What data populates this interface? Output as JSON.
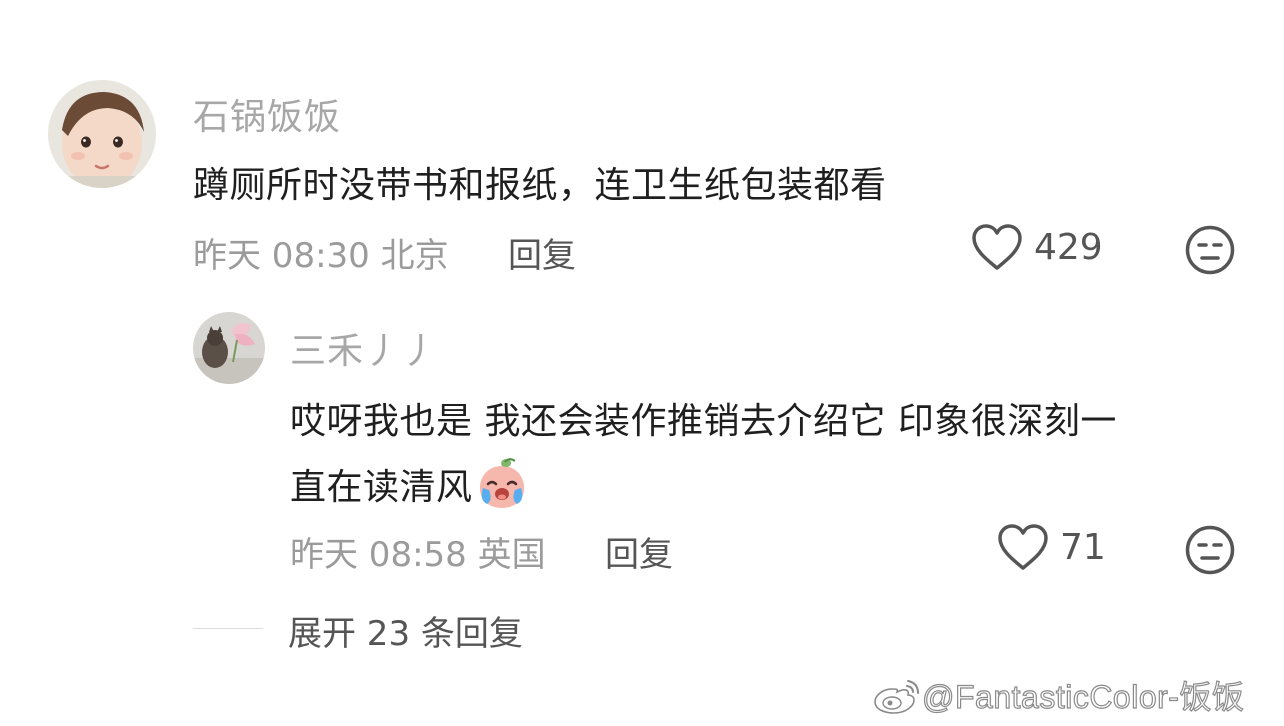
{
  "comments": [
    {
      "username": "石锅饭饭",
      "text": "蹲厕所时没带书和报纸，连卫生纸包装都看",
      "time": "昨天 08:30",
      "location": "北京",
      "reply_label": "回复",
      "likes": "429"
    }
  ],
  "reply": {
    "username": "三禾丿丿",
    "text_line1": "哎呀我也是 我还会装作推销去介绍它 印象很深刻一",
    "text_line2": "直在读清风",
    "time": "昨天 08:58",
    "location": "英国",
    "reply_label": "回复",
    "likes": "71"
  },
  "expand": {
    "label": "展开 23 条回复"
  },
  "watermark": {
    "text": "@FantasticColor-饭饭"
  },
  "icons": {
    "like": "heart-outline-icon",
    "dislike": "neutral-face-icon",
    "emoji": "crying-peach-emoji",
    "watermark_logo": "weibo-logo"
  },
  "colors": {
    "username": "#a7a7a7",
    "text": "#1f1f1f",
    "meta": "#9b9b9b",
    "action": "#555555"
  }
}
